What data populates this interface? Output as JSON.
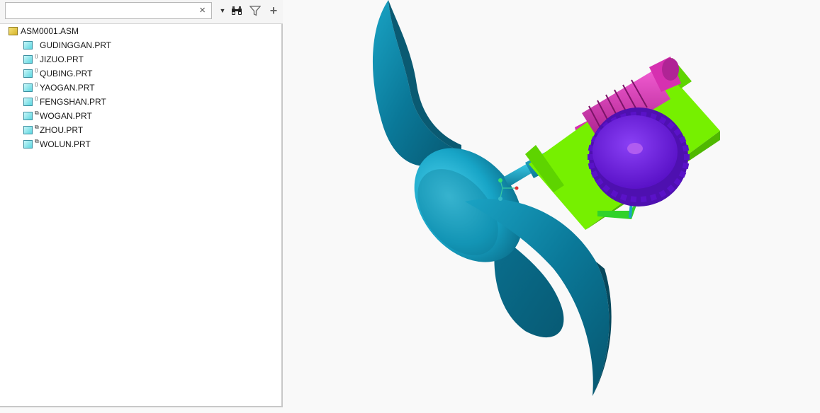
{
  "search": {
    "value": "",
    "placeholder": ""
  },
  "toolbar": {
    "clear_icon": "close-icon",
    "dropdown_icon": "dropdown-arrow-icon",
    "find_icon": "binoculars-icon",
    "filter_icon": "filter-icon",
    "add_icon": "plus-icon"
  },
  "tree": {
    "root": {
      "label": "ASM0001.ASM",
      "icon": "assembly-icon"
    },
    "items": [
      {
        "label": "GUDINGGAN.PRT",
        "marker": ""
      },
      {
        "label": "JIZUO.PRT",
        "marker": "⌷"
      },
      {
        "label": "QUBING.PRT",
        "marker": "⌷"
      },
      {
        "label": "YAOGAN.PRT",
        "marker": "⌷"
      },
      {
        "label": "FENGSHAN.PRT",
        "marker": "⌷"
      },
      {
        "label": "WOGAN.PRT",
        "marker": "⧉"
      },
      {
        "label": "ZHOU.PRT",
        "marker": "⧉"
      },
      {
        "label": "WOLUN.PRT",
        "marker": "⧉"
      }
    ]
  },
  "viewport": {
    "background": "#f9f9f9",
    "colors": {
      "propeller": "#0e86a8",
      "propeller_dark": "#0a5d78",
      "base": "#76f000",
      "worm": "#d630b0",
      "gear": "#6a1ee0",
      "shaft": "#15a6c8"
    }
  }
}
